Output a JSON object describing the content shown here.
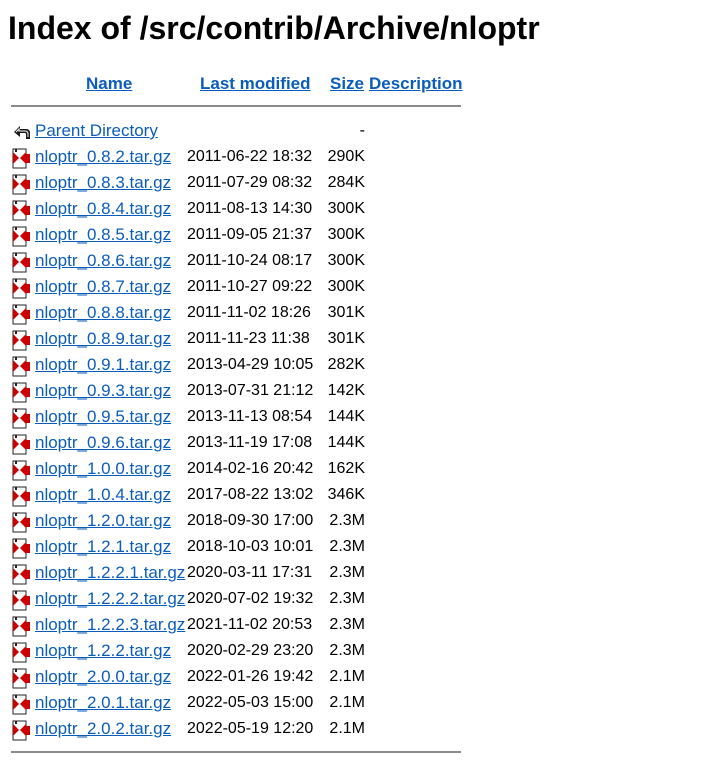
{
  "page": {
    "title": "Index of /src/contrib/Archive/nloptr"
  },
  "columns": {
    "name": "Name",
    "last_modified": "Last modified",
    "size": "Size",
    "description": "Description"
  },
  "parent": {
    "label": "Parent Directory",
    "size": "-",
    "icon": "back-arrow-icon"
  },
  "files": [
    {
      "name": "nloptr_0.8.2.tar.gz",
      "modified": "2011-06-22 18:32",
      "size": "290K"
    },
    {
      "name": "nloptr_0.8.3.tar.gz",
      "modified": "2011-07-29 08:32",
      "size": "284K"
    },
    {
      "name": "nloptr_0.8.4.tar.gz",
      "modified": "2011-08-13 14:30",
      "size": "300K"
    },
    {
      "name": "nloptr_0.8.5.tar.gz",
      "modified": "2011-09-05 21:37",
      "size": "300K"
    },
    {
      "name": "nloptr_0.8.6.tar.gz",
      "modified": "2011-10-24 08:17",
      "size": "300K"
    },
    {
      "name": "nloptr_0.8.7.tar.gz",
      "modified": "2011-10-27 09:22",
      "size": "300K"
    },
    {
      "name": "nloptr_0.8.8.tar.gz",
      "modified": "2011-11-02 18:26",
      "size": "301K"
    },
    {
      "name": "nloptr_0.8.9.tar.gz",
      "modified": "2011-11-23 11:38",
      "size": "301K"
    },
    {
      "name": "nloptr_0.9.1.tar.gz",
      "modified": "2013-04-29 10:05",
      "size": "282K"
    },
    {
      "name": "nloptr_0.9.3.tar.gz",
      "modified": "2013-07-31 21:12",
      "size": "142K"
    },
    {
      "name": "nloptr_0.9.5.tar.gz",
      "modified": "2013-11-13 08:54",
      "size": "144K"
    },
    {
      "name": "nloptr_0.9.6.tar.gz",
      "modified": "2013-11-19 17:08",
      "size": "144K"
    },
    {
      "name": "nloptr_1.0.0.tar.gz",
      "modified": "2014-02-16 20:42",
      "size": "162K"
    },
    {
      "name": "nloptr_1.0.4.tar.gz",
      "modified": "2017-08-22 13:02",
      "size": "346K"
    },
    {
      "name": "nloptr_1.2.0.tar.gz",
      "modified": "2018-09-30 17:00",
      "size": "2.3M"
    },
    {
      "name": "nloptr_1.2.1.tar.gz",
      "modified": "2018-10-03 10:01",
      "size": "2.3M"
    },
    {
      "name": "nloptr_1.2.2.1.tar.gz",
      "modified": "2020-03-11 17:31",
      "size": "2.3M"
    },
    {
      "name": "nloptr_1.2.2.2.tar.gz",
      "modified": "2020-07-02 19:32",
      "size": "2.3M"
    },
    {
      "name": "nloptr_1.2.2.3.tar.gz",
      "modified": "2021-11-02 20:53",
      "size": "2.3M"
    },
    {
      "name": "nloptr_1.2.2.tar.gz",
      "modified": "2020-02-29 23:20",
      "size": "2.3M"
    },
    {
      "name": "nloptr_2.0.0.tar.gz",
      "modified": "2022-01-26 19:42",
      "size": "2.1M"
    },
    {
      "name": "nloptr_2.0.1.tar.gz",
      "modified": "2022-05-03 15:00",
      "size": "2.1M"
    },
    {
      "name": "nloptr_2.0.2.tar.gz",
      "modified": "2022-05-19 12:20",
      "size": "2.1M"
    }
  ],
  "file_icon": "compressed-file-icon",
  "colors": {
    "link": "#0b5dbd",
    "rule": "#8c8c8c",
    "icon_red": "#cc0000"
  }
}
